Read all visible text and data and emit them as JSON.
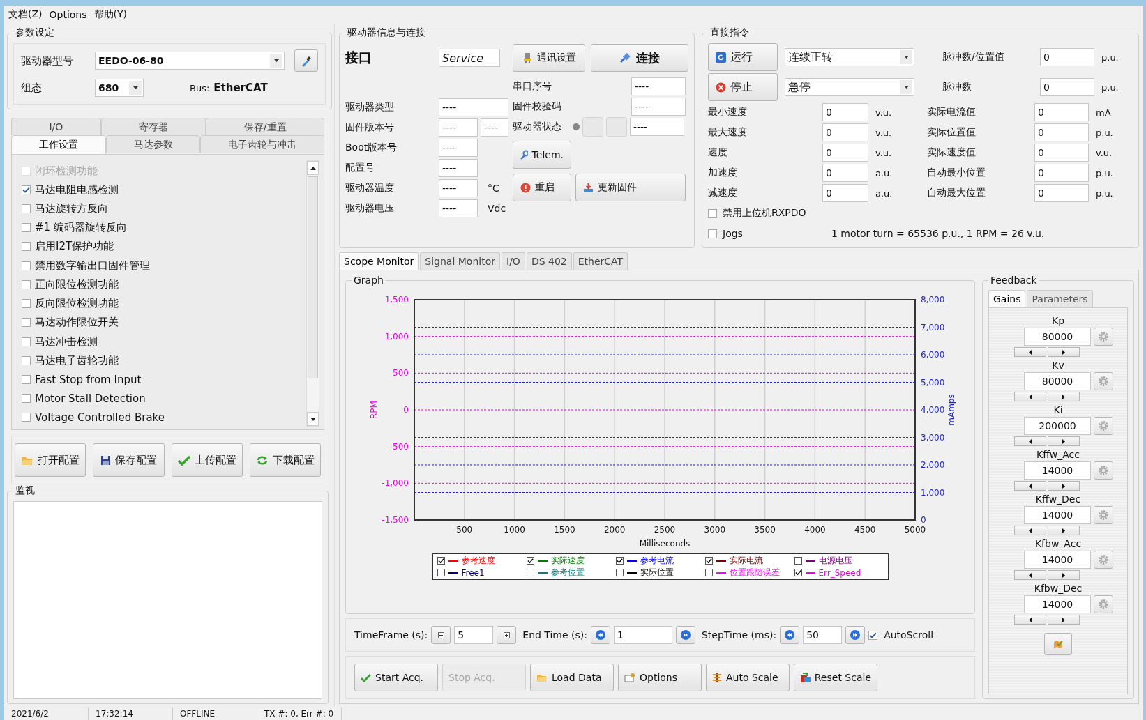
{
  "menu": [
    "文档(Z)",
    "Options",
    "帮助(Y)"
  ],
  "params": {
    "title": "参数设定",
    "model_label": "驱动器型号",
    "model": "EEDO-06-80",
    "config_label": "组态",
    "config": "680",
    "bus_label": "Bus:",
    "bus": "EtherCAT"
  },
  "left_tabs": [
    [
      {
        "label": "I/O",
        "selected": false
      },
      {
        "label": "寄存器",
        "selected": false
      },
      {
        "label": "保存/重置",
        "selected": false
      }
    ],
    [
      {
        "label": "工作设置",
        "selected": true
      },
      {
        "label": "马达参数",
        "selected": false
      },
      {
        "label": "电子齿轮与冲击",
        "selected": false
      }
    ]
  ],
  "options": [
    {
      "label": "闭环检测功能",
      "checked": false,
      "disabled": true
    },
    {
      "label": "马达电阻电感检测",
      "checked": true,
      "disabled": false
    },
    {
      "label": "马达旋转方反向",
      "checked": false,
      "disabled": false
    },
    {
      "label": "#1 编码器旋转反向",
      "checked": false,
      "disabled": false
    },
    {
      "label": "启用I2T保护功能",
      "checked": false,
      "disabled": false
    },
    {
      "label": "禁用数字输出口固件管理",
      "checked": false,
      "disabled": false
    },
    {
      "label": "正向限位检测功能",
      "checked": false,
      "disabled": false
    },
    {
      "label": "反向限位检测功能",
      "checked": false,
      "disabled": false
    },
    {
      "label": "马达动作限位开关",
      "checked": false,
      "disabled": false
    },
    {
      "label": "马达冲击检测",
      "checked": false,
      "disabled": false
    },
    {
      "label": "马达电子齿轮功能",
      "checked": false,
      "disabled": false
    },
    {
      "label": "Fast Stop from Input",
      "checked": false,
      "disabled": false
    },
    {
      "label": "Motor Stall Detection",
      "checked": false,
      "disabled": false
    },
    {
      "label": "Voltage Controlled Brake",
      "checked": false,
      "disabled": false
    }
  ],
  "config_buttons": [
    {
      "label": "打开配置",
      "kind": "folder"
    },
    {
      "label": "保存配置",
      "kind": "floppy"
    },
    {
      "label": "上传配置",
      "kind": "check"
    },
    {
      "label": "下载配置",
      "kind": "cycle"
    }
  ],
  "monitor": {
    "title": "监视"
  },
  "drive_info": {
    "title": "驱动器信息与连接",
    "interface_label": "接口",
    "interface": "Service",
    "comm_button": "通讯设置",
    "connect_button": "连接",
    "rows": [
      {
        "label": "驱动器类型",
        "values": [
          "----"
        ]
      },
      {
        "label": "固件版本号",
        "values": [
          "----",
          "----"
        ]
      },
      {
        "label": "Boot版本号",
        "values": [
          "----"
        ]
      },
      {
        "label": "配置号",
        "values": [
          "----"
        ]
      },
      {
        "label": "驱动器温度",
        "values": [
          "----"
        ],
        "unit": "°C"
      },
      {
        "label": "驱动器电压",
        "values": [
          "----"
        ],
        "unit": "Vdc"
      }
    ],
    "serial_label": "串口序号",
    "serial": "----",
    "checksum_label": "固件校验码",
    "checksum": "----",
    "status_label": "驱动器状态",
    "status": "----",
    "status_led_on": false,
    "telem_button": "Telem.",
    "restart_button": "重启",
    "update_button": "更新固件"
  },
  "direct": {
    "title": "直接指令",
    "run_button": "运行",
    "run_mode": "连续正转",
    "stop_button": "停止",
    "stop_mode": "急停",
    "pulse_fields": [
      {
        "label": "脉冲数/位置值",
        "value": "0",
        "unit": "p.u."
      },
      {
        "label": "脉冲数",
        "value": "0",
        "unit": "p.u."
      }
    ],
    "left_fields": [
      {
        "label": "最小速度",
        "value": "0",
        "unit": "v.u."
      },
      {
        "label": "最大速度",
        "value": "0",
        "unit": "v.u."
      },
      {
        "label": "速度",
        "value": "0",
        "unit": "v.u."
      },
      {
        "label": "加速度",
        "value": "0",
        "unit": "a.u."
      },
      {
        "label": "减速度",
        "value": "0",
        "unit": "a.u."
      }
    ],
    "right_fields": [
      {
        "label": "实际电流值",
        "value": "0",
        "unit": "mA"
      },
      {
        "label": "实际位置值",
        "value": "0",
        "unit": "p.u."
      },
      {
        "label": "实际速度值",
        "value": "0",
        "unit": "v.u."
      },
      {
        "label": "自动最小位置",
        "value": "0",
        "unit": "p.u."
      },
      {
        "label": "自动最大位置",
        "value": "0",
        "unit": "p.u."
      }
    ],
    "rxpdo": {
      "label": "禁用上位机RXPDO",
      "checked": false
    },
    "jogs": {
      "label": "Jogs",
      "checked": false
    },
    "note": "1 motor turn = 65536 p.u., 1 RPM = 26 v.u."
  },
  "scope_tabs": [
    {
      "label": "Scope Monitor",
      "selected": true
    },
    {
      "label": "Signal Monitor",
      "selected": false
    },
    {
      "label": "I/O",
      "selected": false
    },
    {
      "label": "DS 402",
      "selected": false
    },
    {
      "label": "EtherCAT",
      "selected": false
    }
  ],
  "graph": {
    "title": "Graph",
    "chart_data": {
      "type": "line",
      "grid": true,
      "xlabel": "Milliseconds",
      "ylabel": "RPM",
      "xlim": [
        0,
        5000
      ],
      "ylim": [
        -1500,
        1500
      ],
      "xticks": [
        500,
        1000,
        1500,
        2000,
        2500,
        3000,
        3500,
        4000,
        4500,
        5000
      ],
      "yticks": [
        {
          "value": -1500,
          "label": "-1,500"
        },
        {
          "value": -1000,
          "label": "-1,000"
        },
        {
          "value": -500,
          "label": "-500"
        },
        {
          "value": 0,
          "label": "0"
        },
        {
          "value": 500,
          "label": "500"
        },
        {
          "value": 1000,
          "label": "1,000"
        },
        {
          "value": 1500,
          "label": "1,500"
        }
      ],
      "y2label": "mAmps",
      "y2lim": [
        0,
        8000
      ],
      "y2ticks": [
        {
          "value": 0,
          "label": "0"
        },
        {
          "value": 1000,
          "label": "1,000"
        },
        {
          "value": 2000,
          "label": "2,000"
        },
        {
          "value": 3000,
          "label": "3,000"
        },
        {
          "value": 4000,
          "label": "4,000"
        },
        {
          "value": 5000,
          "label": "5,000"
        },
        {
          "value": 6000,
          "label": "6,000"
        },
        {
          "value": 7000,
          "label": "7,000"
        },
        {
          "value": 8000,
          "label": "8,000"
        }
      ]
    },
    "legend": [
      {
        "name": "参考速度",
        "color": "#ff0000",
        "checked": true
      },
      {
        "name": "实际速度",
        "color": "#008000",
        "checked": true
      },
      {
        "name": "参考电流",
        "color": "#0000ff",
        "checked": true
      },
      {
        "name": "实际电流",
        "color": "#800000",
        "checked": true
      },
      {
        "name": "电源电压",
        "color": "#800080",
        "checked": false
      },
      {
        "name": "Free1",
        "color": "#000080",
        "checked": false
      },
      {
        "name": "参考位置",
        "color": "#008080",
        "checked": false
      },
      {
        "name": "实际位置",
        "color": "#000000",
        "checked": false
      },
      {
        "name": "位置跟随误差",
        "color": "#ff00ff",
        "checked": false
      },
      {
        "name": "Err_Speed",
        "color": "#ee00ee",
        "checked": true
      }
    ]
  },
  "timing": {
    "timeframe_label": "TimeFrame (s):",
    "timeframe": "5",
    "endtime_label": "End Time (s):",
    "endtime": "1",
    "steptime_label": "StepTime (ms):",
    "steptime": "50",
    "autoscroll_label": "AutoScroll",
    "autoscroll": true
  },
  "acq_buttons": [
    {
      "label": "Start Acq.",
      "kind": "check",
      "disabled": false
    },
    {
      "label": "Stop Acq.",
      "kind": "plain",
      "disabled": true
    },
    {
      "label": "Load Data",
      "kind": "folder",
      "disabled": false
    },
    {
      "label": "Options",
      "kind": "options",
      "disabled": false
    },
    {
      "label": "Auto Scale",
      "kind": "scale",
      "disabled": false
    },
    {
      "label": "Reset Scale",
      "kind": "reset",
      "disabled": false
    }
  ],
  "feedback": {
    "title": "Feedback",
    "tabs": [
      {
        "label": "Gains",
        "selected": true
      },
      {
        "label": "Parameters",
        "selected": false
      }
    ],
    "gains": [
      {
        "name": "Kp",
        "value": "80000"
      },
      {
        "name": "Kv",
        "value": "80000"
      },
      {
        "name": "Ki",
        "value": "200000"
      },
      {
        "name": "Kffw_Acc",
        "value": "14000"
      },
      {
        "name": "Kffw_Dec",
        "value": "14000"
      },
      {
        "name": "Kfbw_Acc",
        "value": "14000"
      },
      {
        "name": "Kfbw_Dec",
        "value": "14000"
      }
    ]
  },
  "status_bar": [
    "2021/6/2",
    "17:32:14",
    "OFFLINE",
    "TX #: 0, Err #: 0"
  ]
}
